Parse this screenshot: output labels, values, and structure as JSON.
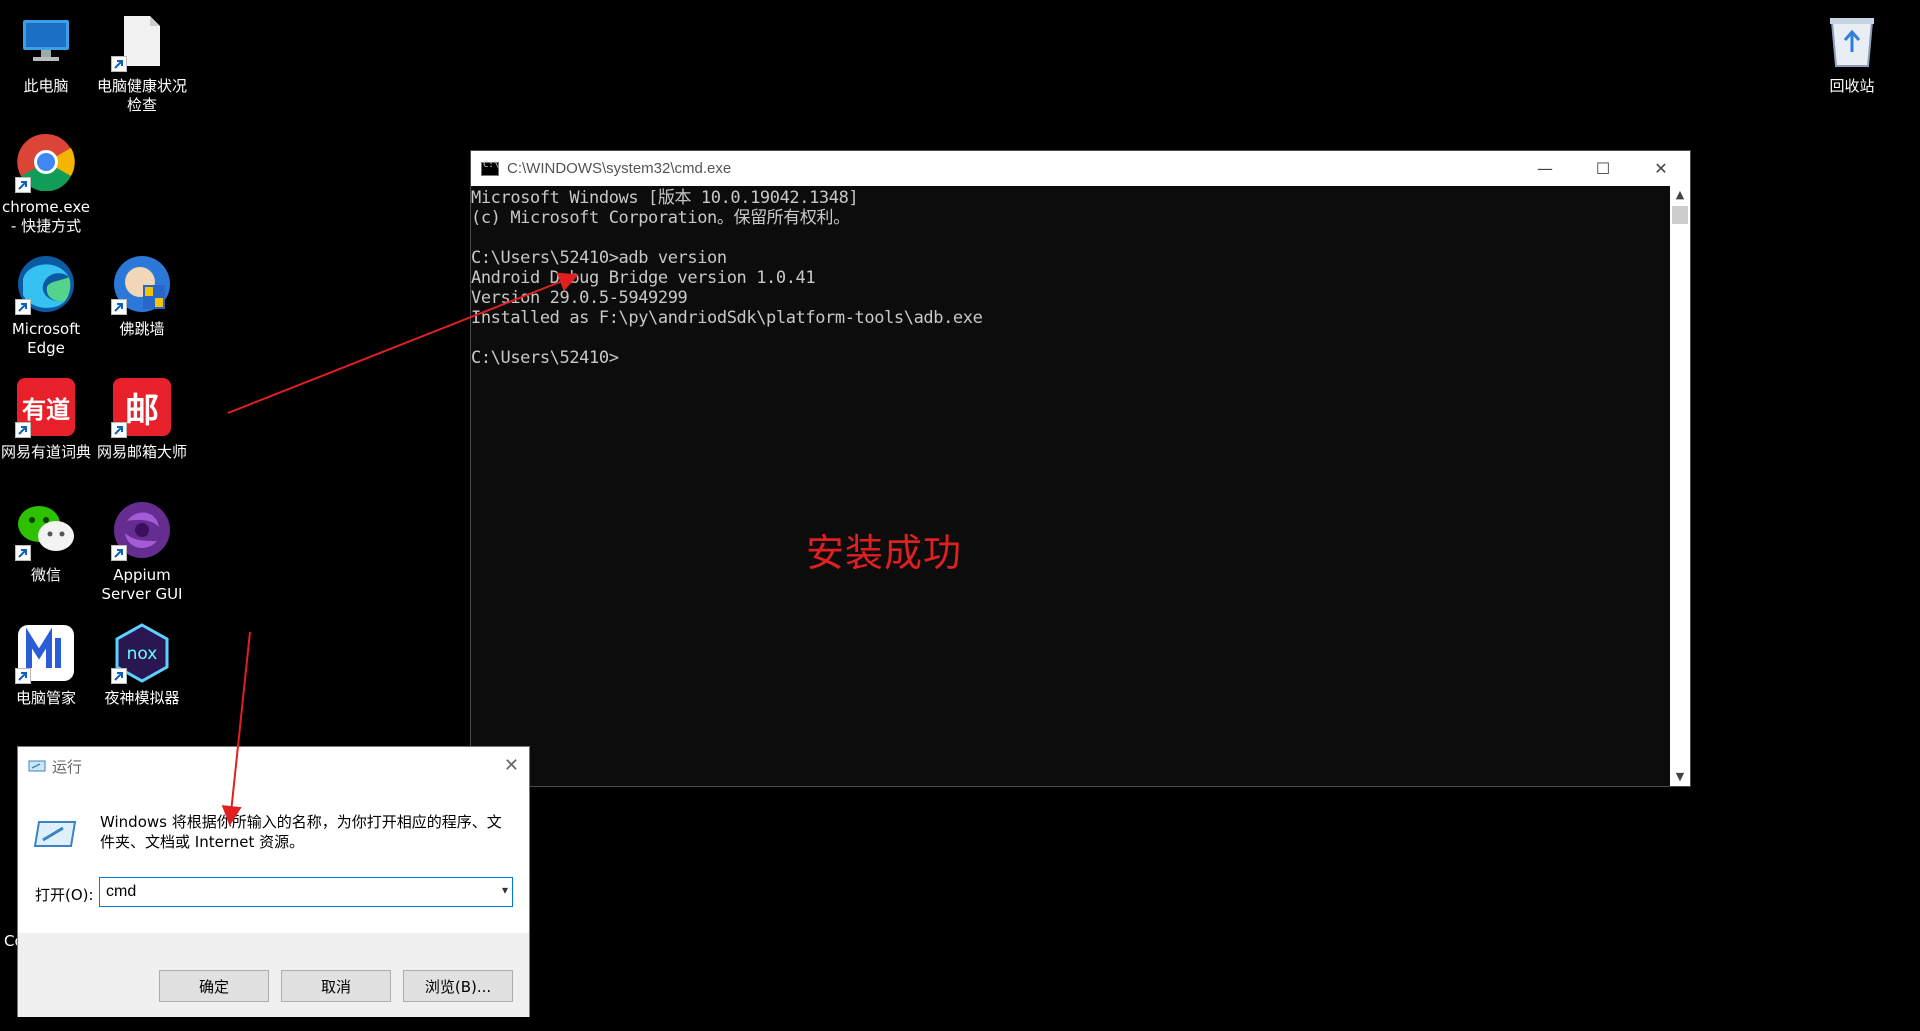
{
  "desktop": {
    "icons": [
      {
        "label": "此电脑",
        "icon": "computer-icon"
      },
      {
        "label": "电脑健康状况\n检查",
        "icon": "document-icon"
      },
      {
        "label": "chrome.exe\n- 快捷方式",
        "icon": "chrome-icon"
      },
      {
        "label": "Microsoft\nEdge",
        "icon": "edge-icon"
      },
      {
        "label": "佛跳墙",
        "icon": "foxiaoqiang-icon"
      },
      {
        "label": "网易有道词典",
        "icon": "youdao-icon"
      },
      {
        "label": "网易邮箱大师",
        "icon": "mail-master-icon"
      },
      {
        "label": "微信",
        "icon": "wechat-icon"
      },
      {
        "label": "Appium\nServer GUI",
        "icon": "appium-icon"
      },
      {
        "label": "电脑管家",
        "icon": "pc-manager-icon"
      },
      {
        "label": "夜神模拟器",
        "icon": "nox-icon"
      },
      {
        "label": "回收站",
        "icon": "recycle-bin-icon"
      }
    ],
    "youdao_glyph": "有道",
    "mail_glyph": "邮",
    "nox_glyph": "nox",
    "partial_label": "Co"
  },
  "cmd_window": {
    "title": "C:\\WINDOWS\\system32\\cmd.exe",
    "lines": [
      "Microsoft Windows [版本 10.0.19042.1348]",
      "(c) Microsoft Corporation。保留所有权利。",
      "",
      "C:\\Users\\52410>adb version",
      "Android Debug Bridge version 1.0.41",
      "Version 29.0.5-5949299",
      "Installed as F:\\py\\andriodSdk\\platform-tools\\adb.exe",
      "",
      "C:\\Users\\52410>"
    ],
    "minimize_glyph": "—",
    "maximize_glyph": "☐",
    "close_glyph": "✕"
  },
  "annotation": {
    "text": "安装成功",
    "color": "#e02020"
  },
  "run_dialog": {
    "title": "运行",
    "description": "Windows 将根据你所输入的名称，为你打开相应的程序、文件夹、文档或 Internet 资源。",
    "open_label": "打开(O):",
    "input_value": "cmd",
    "ok_button": "确定",
    "cancel_button": "取消",
    "browse_button": "浏览(B)...",
    "close_glyph": "✕"
  }
}
